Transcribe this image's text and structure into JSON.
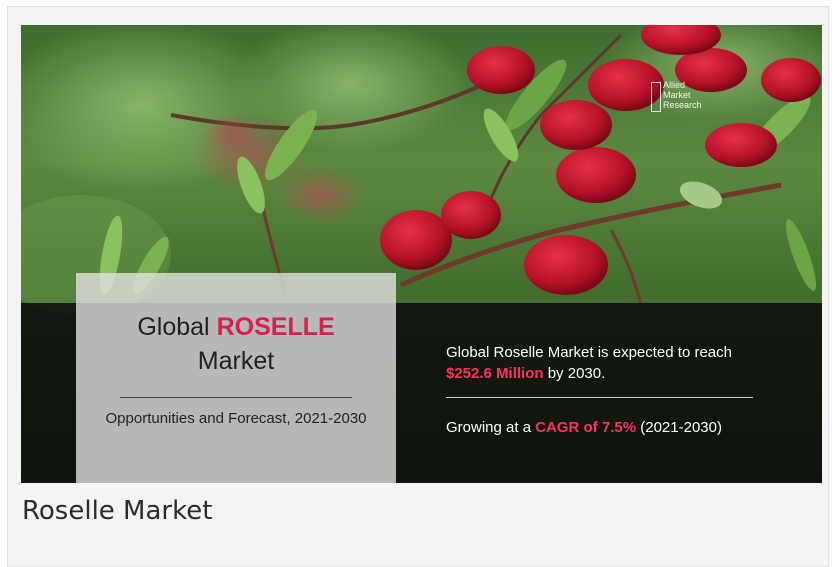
{
  "banner": {
    "title_prefix": "Global ",
    "title_highlight": "ROSELLE",
    "title_line2": "Market",
    "subtitle": "Opportunities and Forecast, 2021-2030",
    "stat1_prefix": "Global Roselle Market is expected to reach ",
    "stat1_highlight": "$252.6 Million",
    "stat1_suffix": " by 2030.",
    "stat2_prefix": "Growing at a ",
    "stat2_highlight": "CAGR of 7.5%",
    "stat2_suffix": " (2021-2030)",
    "logo_lines": [
      "Allied",
      "Market",
      "Research"
    ]
  },
  "caption": "Roselle Market",
  "colors": {
    "accent": "#d81f4f",
    "accent_on_dark": "#ff2f64",
    "band": "#0a0a0a"
  }
}
